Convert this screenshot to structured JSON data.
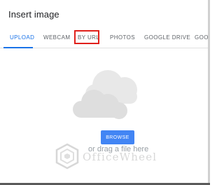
{
  "dialog": {
    "title": "Insert image"
  },
  "tabs": [
    {
      "label": "UPLOAD",
      "active": true
    },
    {
      "label": "WEBCAM",
      "active": false
    },
    {
      "label": "BY URL",
      "active": false,
      "highlighted": true
    },
    {
      "label": "PHOTOS",
      "active": false
    },
    {
      "label": "GOOGLE DRIVE",
      "active": false
    },
    {
      "label": "GOO",
      "active": false
    }
  ],
  "upload": {
    "browse_label": "BROWSE",
    "drag_text": "or drag a file here",
    "illustration_icon": "cloud-icon"
  },
  "watermark": {
    "text": "OfficeWheel",
    "icon": "officewheel-logo"
  },
  "colors": {
    "accent": "#1a73e8",
    "browse_bg": "#4285f4",
    "highlight": "#e0201b",
    "cloud": "#e8e8e8"
  }
}
